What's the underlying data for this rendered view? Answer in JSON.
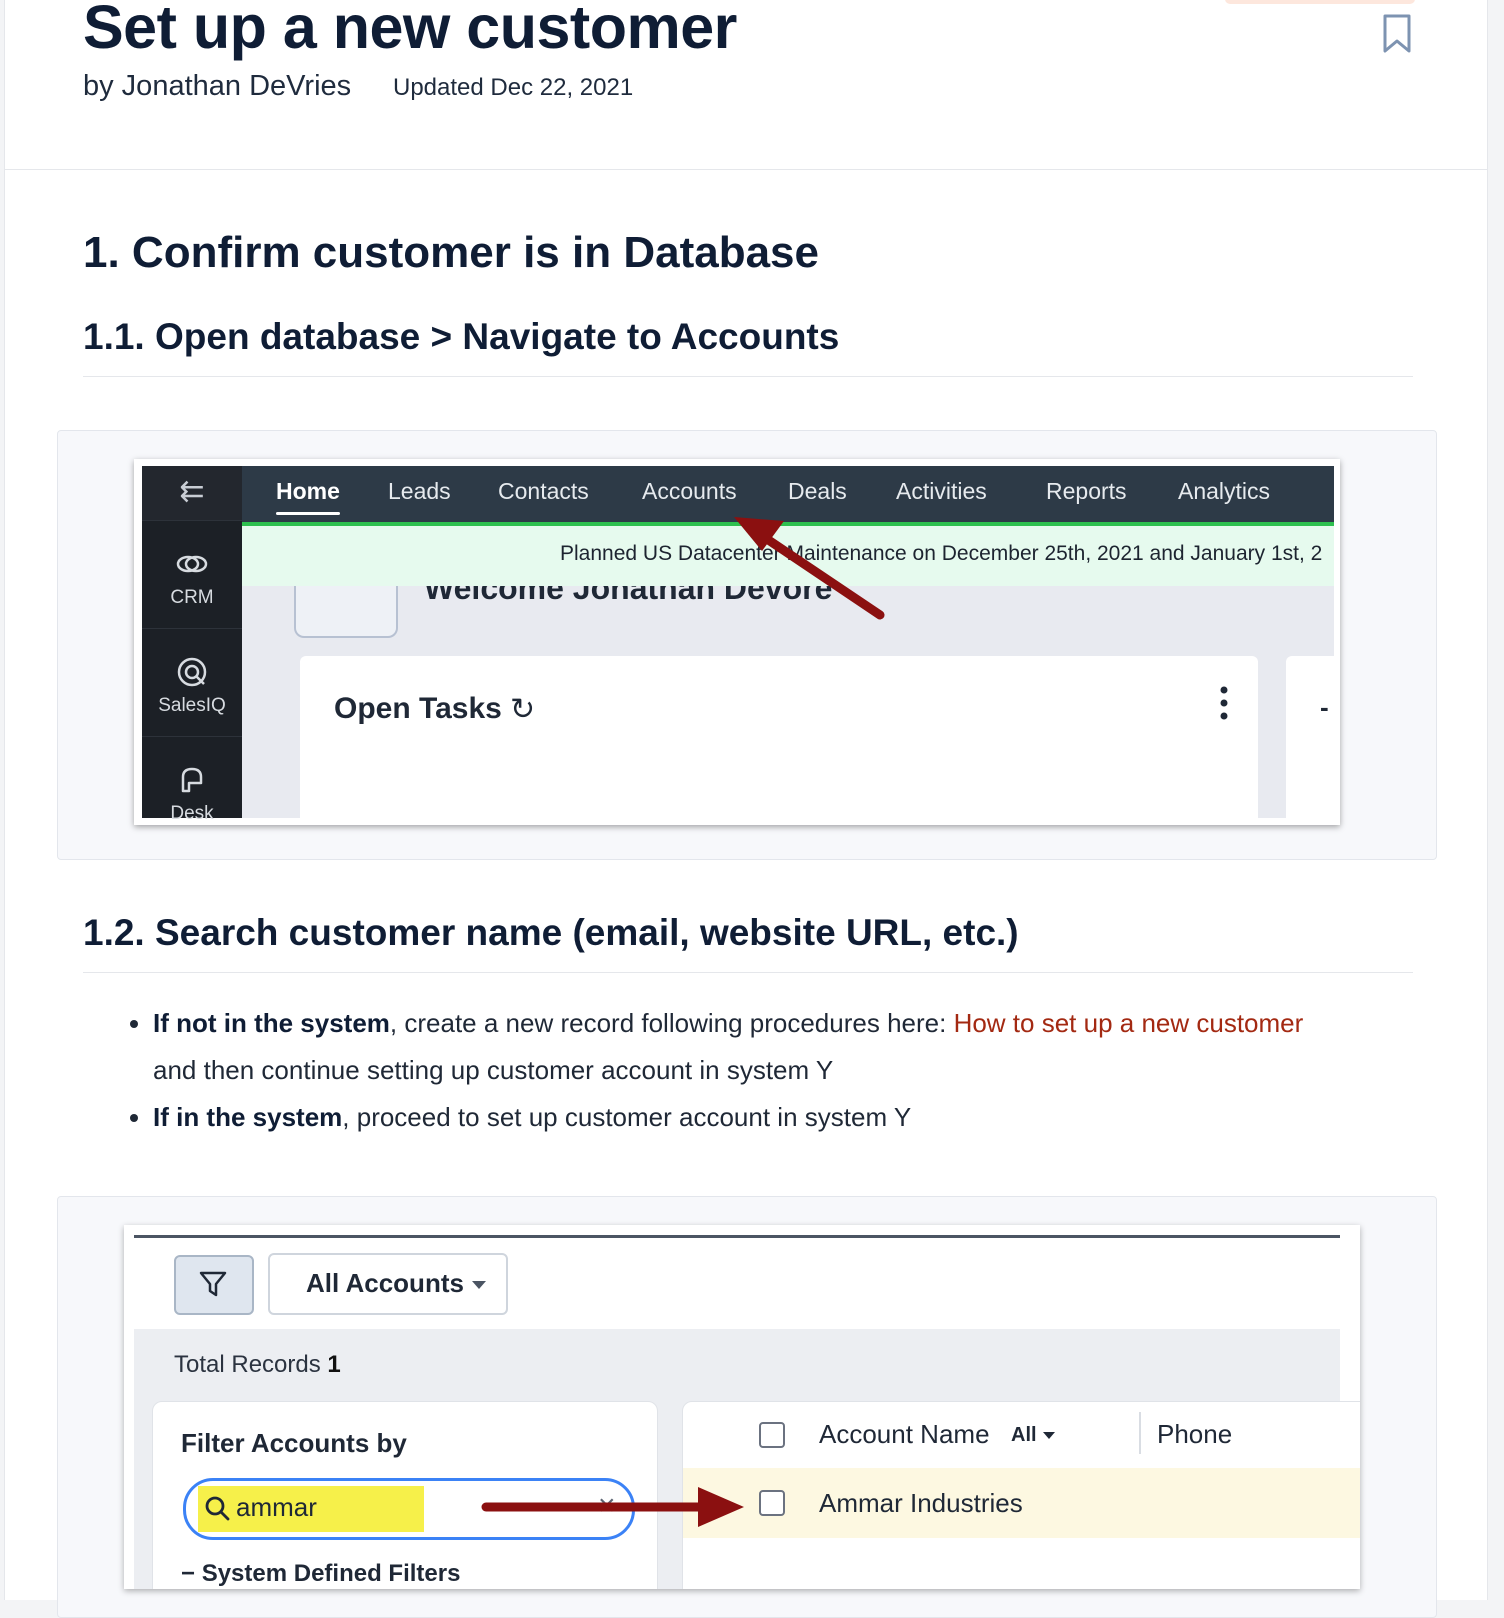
{
  "article": {
    "title": "Set up a new customer",
    "author": "by Jonathan DeVries",
    "updated": "Updated Dec 22, 2021",
    "bookmark_icon": "bookmark-icon"
  },
  "section1": {
    "heading": "1. Confirm customer is in Database",
    "step1": {
      "heading": "1.1. Open database > Navigate to Accounts"
    },
    "step2": {
      "heading": "1.2. Search customer name (email, website URL, etc.)",
      "bullets": [
        {
          "bold": "If not in the system",
          "text_before_link": ", create a new record following procedures here: ",
          "link": "How to set up a new customer",
          "text_after_link": "and then continue setting up customer account in system Y"
        },
        {
          "bold": "If in the system",
          "text": ", proceed to set up customer account in system Y"
        }
      ]
    }
  },
  "screenshot1": {
    "apps": [
      {
        "label": "CRM",
        "icon": "crm-icon"
      },
      {
        "label": "SalesIQ",
        "icon": "salesiq-icon"
      },
      {
        "label": "Desk",
        "icon": "desk-icon"
      }
    ],
    "nav_tabs": [
      "Home",
      "Leads",
      "Contacts",
      "Accounts",
      "Deals",
      "Activities",
      "Reports",
      "Analytics"
    ],
    "active_tab": "Home",
    "banner": "Planned US Datacenter Maintenance on December 25th, 2021 and January 1st, 2",
    "welcome": "Welcome Jonathan Devore",
    "open_tasks": "Open Tasks",
    "colors": {
      "nav": "#2d3a47",
      "banner": "#e6faee",
      "green_bar": "#2ec04f",
      "arrow": "#8b1010"
    }
  },
  "screenshot2": {
    "view_selector": "All Accounts",
    "total_records_label": "Total Records",
    "total_records_count": "1",
    "filter_title": "Filter Accounts by",
    "search_value": "ammar",
    "system_filters": "System Defined Filters",
    "columns": {
      "account_name": "Account Name",
      "all": "All",
      "phone": "Phone"
    },
    "rows": [
      {
        "account_name": "Ammar Industries"
      }
    ],
    "colors": {
      "highlight": "#f6f04a",
      "search_border": "#3b82f6",
      "row": "#fdf8e1"
    }
  }
}
